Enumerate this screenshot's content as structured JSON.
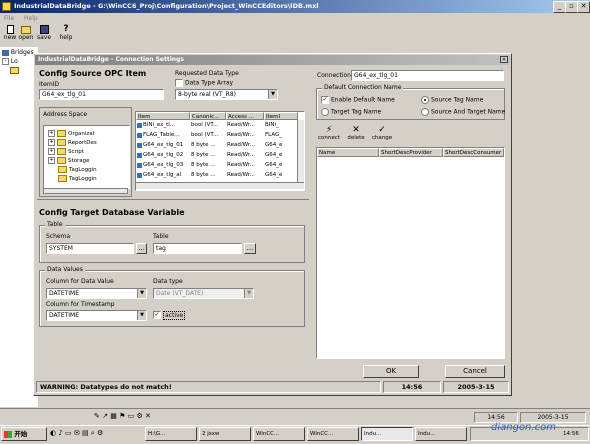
{
  "main_window": {
    "title": "IndustrialDataBridge - G:\\WinCC6_Proj\\Configuration\\Project_WinCCEditors\\IDB.mxl",
    "menu": [
      "File",
      "Help"
    ],
    "toolbar": [
      {
        "label": "new",
        "icon": "new-file-icon"
      },
      {
        "label": "open",
        "icon": "open-folder-icon"
      },
      {
        "label": "save",
        "icon": "save-disk-icon"
      },
      {
        "label": "help",
        "icon": "help-question-icon"
      }
    ],
    "tree_root": "Bridges",
    "tree_child": "Lo",
    "status_time": "14:56",
    "status_date": "2005-3-15"
  },
  "dialog": {
    "title": "IndustrialDataBridge - Connection Settings",
    "source": {
      "heading": "Config Source OPC Item",
      "itemid_label": "ItemID",
      "itemid_value": "G64_ex_tlg_01",
      "req_type_label": "Requested Data Type",
      "data_type_array_label": "Data Type Array",
      "req_type_value": "8-byte real (VT_R8)",
      "address_space_label": "Address Space",
      "tree_items": [
        "Organizat",
        "ReportDes",
        "Script",
        "Storage",
        "TagLoggin",
        "TagLoggin"
      ],
      "list_headers": [
        "Item",
        "Canonic...",
        "Access ...",
        "ItemI"
      ],
      "list_rows": [
        [
          "BINi_ex_tl...",
          "bool (VT...",
          "Read/Wr...",
          "BINi_"
        ],
        [
          "FLAG_Table...",
          "bool (VT...",
          "Read/Wr...",
          "FLAG_"
        ],
        [
          "G64_ex_tlg_01",
          "8 byte ...",
          "Read/Wr...",
          "G64_e"
        ],
        [
          "G64_ex_tlg_02",
          "8 byte ...",
          "Read/Wr...",
          "G64_e"
        ],
        [
          "G64_ex_tlg_03",
          "8 byte ...",
          "Read/Wr...",
          "G64_e"
        ],
        [
          "G64_ex_tlg_al",
          "8 byte ...",
          "Read/Wr...",
          "G64_e"
        ]
      ]
    },
    "target": {
      "heading": "Config Target Database Variable",
      "table_group": "Table",
      "schema_label": "Schema",
      "schema_value": "SYSTEM",
      "table_label": "Table",
      "table_value": "tag",
      "browse": "...",
      "values_group": "Data Values",
      "col_value_label": "Column for Data Value",
      "col_value_value": "DATETIME",
      "data_type_label": "Data type",
      "data_type_value": "Date (VT_DATE)",
      "col_ts_label": "Column for Timestamp",
      "col_ts_value": "DATETIME",
      "active_label": "active"
    },
    "connection": {
      "label": "Connection:",
      "value": "G64_ex_tlg_01",
      "default_name_group": "Default Connection Name",
      "enable_default_label": "Enable Default Name",
      "source_tag_label": "Source Tag Name",
      "target_tag_label": "Target Tag Name",
      "source_target_label": "Source And Target Name",
      "actions": [
        {
          "label": "connect",
          "icon": "connect-icon"
        },
        {
          "label": "delete",
          "icon": "delete-x-icon"
        },
        {
          "label": "change",
          "icon": "checkmark-icon"
        }
      ],
      "table_headers": [
        "Name",
        "ShortDescProvider",
        "ShortDescConsumer"
      ]
    },
    "ok": "OK",
    "cancel": "Cancel",
    "warning": "WARNING: Datatypes do not match!",
    "status_time": "14:56",
    "status_date": "2005-3-15"
  },
  "taskbar": {
    "start": "开始",
    "tasks": [
      "H:\\G...",
      "2 jsxw",
      "WinCC...",
      "WinCC...",
      "Indu...",
      "Indu..."
    ],
    "clock": "14:56",
    "watermark": "diangon.com"
  },
  "colors": {
    "title_active": "#0a246a",
    "title_inactive": "#808080",
    "face": "#d4d0c8"
  }
}
